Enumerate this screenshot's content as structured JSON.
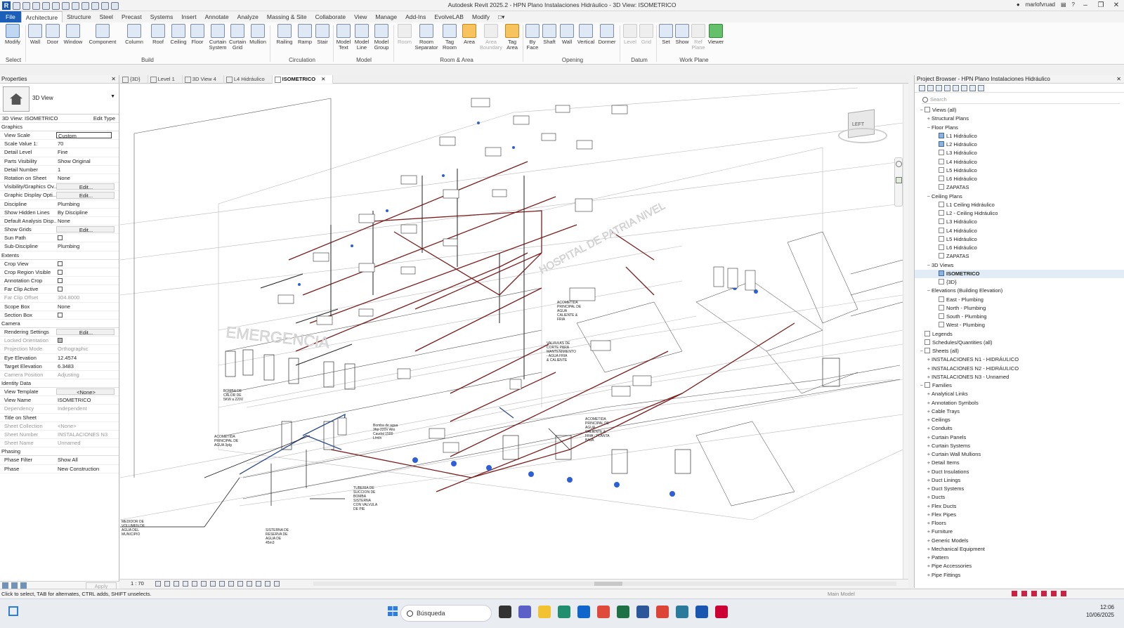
{
  "app": {
    "title": "Autodesk Revit 2025.2 - HPN Plano Instalaciones Hidráulico - 3D View: ISOMETRICO",
    "user": "marlofvruad"
  },
  "ribbon_tabs": [
    "File",
    "Architecture",
    "Structure",
    "Steel",
    "Precast",
    "Systems",
    "Insert",
    "Annotate",
    "Analyze",
    "Massing & Site",
    "Collaborate",
    "View",
    "Manage",
    "Add-Ins",
    "EvolveLAB",
    "Modify"
  ],
  "ribbon_active": "Architecture",
  "tools": {
    "modify": "Modify",
    "wall": "Wall",
    "door": "Door",
    "window": "Window",
    "component": "Component",
    "column": "Column",
    "roof": "Roof",
    "ceiling": "Ceiling",
    "floor": "Floor",
    "curtain_system": "Curtain System",
    "curtain_grid": "Curtain Grid",
    "mullion": "Mullion",
    "railing": "Railing",
    "ramp": "Ramp",
    "stair": "Stair",
    "model_text": "Model Text",
    "model_line": "Model Line",
    "model_group": "Model Group",
    "room": "Room",
    "room_separator": "Room Separator",
    "tag_room": "Tag Room",
    "area": "Area",
    "area_boundary": "Area Boundary",
    "tag_area": "Tag Area",
    "by_face": "By Face",
    "shaft": "Shaft",
    "wall_opening": "Wall",
    "vertical": "Vertical",
    "dormer": "Dormer",
    "level": "Level",
    "grid": "Grid",
    "set": "Set",
    "show": "Show",
    "ref_plane": "Ref Plane",
    "viewer": "Viewer"
  },
  "panels": {
    "select": "Select",
    "build": "Build",
    "circulation": "Circulation",
    "model": "Model",
    "room_area": "Room & Area",
    "opening": "Opening",
    "datum": "Datum",
    "work_plane": "Work Plane"
  },
  "properties": {
    "title": "Properties",
    "type_name": "3D View",
    "instance": "3D View: ISOMETRICO",
    "edit_type": "Edit Type",
    "groups": [
      {
        "name": "Graphics",
        "rows": [
          {
            "k": "View Scale",
            "v": "Custom",
            "kind": "input"
          },
          {
            "k": "Scale Value    1:",
            "v": "70"
          },
          {
            "k": "Detail Level",
            "v": "Fine"
          },
          {
            "k": "Parts Visibility",
            "v": "Show Original"
          },
          {
            "k": "Detail Number",
            "v": "1"
          },
          {
            "k": "Rotation on Sheet",
            "v": "None"
          },
          {
            "k": "Visibility/Graphics Ov...",
            "v": "Edit...",
            "kind": "btn"
          },
          {
            "k": "Graphic Display Opti...",
            "v": "Edit...",
            "kind": "btn"
          },
          {
            "k": "Discipline",
            "v": "Plumbing"
          },
          {
            "k": "Show Hidden Lines",
            "v": "By Discipline"
          },
          {
            "k": "Default Analysis Disp...",
            "v": "None"
          },
          {
            "k": "Show Grids",
            "v": "Edit...",
            "kind": "btn"
          },
          {
            "k": "Sun Path",
            "v": "",
            "kind": "check"
          },
          {
            "k": "Sub-Discipline",
            "v": "Plumbing"
          }
        ]
      },
      {
        "name": "Extents",
        "rows": [
          {
            "k": "Crop View",
            "v": "",
            "kind": "check"
          },
          {
            "k": "Crop Region Visible",
            "v": "",
            "kind": "check"
          },
          {
            "k": "Annotation Crop",
            "v": "",
            "kind": "check"
          },
          {
            "k": "Far Clip Active",
            "v": "",
            "kind": "check"
          },
          {
            "k": "Far Clip Offset",
            "v": "304.8000",
            "dim": true
          },
          {
            "k": "Scope Box",
            "v": "None"
          },
          {
            "k": "Section Box",
            "v": "",
            "kind": "check"
          }
        ]
      },
      {
        "name": "Camera",
        "rows": [
          {
            "k": "Rendering Settings",
            "v": "Edit...",
            "kind": "btn"
          },
          {
            "k": "Locked Orientation",
            "v": "",
            "kind": "checkon",
            "dim": true
          },
          {
            "k": "Projection Mode",
            "v": "Orthographic",
            "dim": true
          },
          {
            "k": "Eye Elevation",
            "v": "12.4574"
          },
          {
            "k": "Target Elevation",
            "v": "6.3483"
          },
          {
            "k": "Camera Position",
            "v": "Adjusting",
            "dim": true
          }
        ]
      },
      {
        "name": "Identity Data",
        "rows": [
          {
            "k": "View Template",
            "v": "<None>",
            "kind": "btn"
          },
          {
            "k": "View Name",
            "v": "ISOMETRICO"
          },
          {
            "k": "Dependency",
            "v": "Independent",
            "dim": true
          },
          {
            "k": "Title on Sheet",
            "v": ""
          },
          {
            "k": "Sheet Collection",
            "v": "<None>",
            "dim": true
          },
          {
            "k": "Sheet Number",
            "v": "INSTALACIONES N3",
            "dim": true
          },
          {
            "k": "Sheet Name",
            "v": "Unnamed",
            "dim": true
          }
        ]
      },
      {
        "name": "Phasing",
        "rows": [
          {
            "k": "Phase Filter",
            "v": "Show All"
          },
          {
            "k": "Phase",
            "v": "New Construction"
          }
        ]
      }
    ],
    "apply": "Apply"
  },
  "view_tabs": [
    {
      "label": "{3D}"
    },
    {
      "label": "Level 1"
    },
    {
      "label": "3D View 4"
    },
    {
      "label": "L4 Hidráulico"
    },
    {
      "label": "ISOMETRICO",
      "active": true
    }
  ],
  "view_scale": "1 : 70",
  "viewcube": "LEFT",
  "annotations": {
    "emergencia": "EMERGENCIA",
    "hospital": "HOSPITAL DE PATRIA NIVEL",
    "acometida1": [
      "ACOMETIDA",
      "PRINCIPAL DE",
      "AGUA",
      "CALIENTE &",
      "FRIA"
    ],
    "valvulas": [
      "VALVULAS DE",
      "CORTE PARA",
      "MANTENIMIENTO",
      "- AGUA FRIA",
      "& CALIENTE"
    ],
    "bomba_calor": [
      "BOMBA DE",
      "CALOR DE",
      "5KW a 220V"
    ],
    "acometida3": [
      "ACOMETIDA",
      "PRINCIPAL DE",
      "AGUA 3plg"
    ],
    "bomba_agua": [
      "Bomba de agua",
      "3hp-220V Alto",
      "Caudal 1500",
      "L/min"
    ],
    "acometida_baja": [
      "ACOMETIDA",
      "PRINCIPAL DE",
      "AGUA",
      "CALIENTE &",
      "FRIA - PLANTA",
      "BAJA"
    ],
    "tuberia": [
      "TUBERIA DE",
      "SUCCION DE",
      "BOMBA",
      "SISTERNA",
      "CON VALVULA",
      "DE PIE"
    ],
    "medidor": [
      "MEDIDOR DE",
      "VOLUMEN DE",
      "AGUA DEL",
      "MUNICIPIO"
    ],
    "sisterna": [
      "SISTERNA DE",
      "RESERVA DE",
      "AGUA DE",
      "45m3"
    ]
  },
  "browser": {
    "title": "Project Browser - HPN Plano Instalaciones Hidráulico",
    "search_placeholder": "Search",
    "tree": [
      {
        "t": "Views (all)",
        "d": 0,
        "tg": "−",
        "ic": true
      },
      {
        "t": "Structural Plans",
        "d": 1,
        "tg": "+"
      },
      {
        "t": "Floor Plans",
        "d": 1,
        "tg": "−"
      },
      {
        "t": "L1 Hidráulico",
        "d": 2,
        "ic": "blue"
      },
      {
        "t": "L2 Hidráulico",
        "d": 2,
        "ic": "blue"
      },
      {
        "t": "L3 Hidráulico",
        "d": 2,
        "ic": true
      },
      {
        "t": "L4 Hidráulico",
        "d": 2,
        "ic": true
      },
      {
        "t": "L5 Hidráulico",
        "d": 2,
        "ic": true
      },
      {
        "t": "L6 Hidráulico",
        "d": 2,
        "ic": true
      },
      {
        "t": "ZAPATAS",
        "d": 2,
        "ic": true
      },
      {
        "t": "Ceiling Plans",
        "d": 1,
        "tg": "−"
      },
      {
        "t": "L1 Ceiling Hidráulico",
        "d": 2,
        "ic": true
      },
      {
        "t": "L2 - Ceiling Hidráulico",
        "d": 2,
        "ic": true
      },
      {
        "t": "L3 Hidráulico",
        "d": 2,
        "ic": true
      },
      {
        "t": "L4 Hidráulico",
        "d": 2,
        "ic": true
      },
      {
        "t": "L5 Hidráulico",
        "d": 2,
        "ic": true
      },
      {
        "t": "L6 Hidráulico",
        "d": 2,
        "ic": true
      },
      {
        "t": "ZAPATAS",
        "d": 2,
        "ic": true
      },
      {
        "t": "3D Views",
        "d": 1,
        "tg": "−"
      },
      {
        "t": "ISOMETRICO",
        "d": 2,
        "ic": "blue",
        "sel": true
      },
      {
        "t": "{3D}",
        "d": 2,
        "ic": true
      },
      {
        "t": "Elevations (Building Elevation)",
        "d": 1,
        "tg": "−"
      },
      {
        "t": "East - Plumbing",
        "d": 2,
        "ic": true
      },
      {
        "t": "North - Plumbing",
        "d": 2,
        "ic": true
      },
      {
        "t": "South - Plumbing",
        "d": 2,
        "ic": true
      },
      {
        "t": "West - Plumbing",
        "d": 2,
        "ic": true
      },
      {
        "t": "Legends",
        "d": 0,
        "ic": true
      },
      {
        "t": "Schedules/Quantities (all)",
        "d": 0,
        "ic": true
      },
      {
        "t": "Sheets (all)",
        "d": 0,
        "tg": "−",
        "ic": true
      },
      {
        "t": "INSTALACIONES N1 - HIDRÁULICO",
        "d": 1,
        "tg": "+"
      },
      {
        "t": "INSTALACIONES N2 - HIDRÁULICO",
        "d": 1,
        "tg": "+"
      },
      {
        "t": "INSTALACIONES N3 - Unnamed",
        "d": 1,
        "tg": "+"
      },
      {
        "t": "Families",
        "d": 0,
        "tg": "−",
        "ic": true
      },
      {
        "t": "Analytical Links",
        "d": 1,
        "tg": "+"
      },
      {
        "t": "Annotation Symbols",
        "d": 1,
        "tg": "+"
      },
      {
        "t": "Cable Trays",
        "d": 1,
        "tg": "+"
      },
      {
        "t": "Ceilings",
        "d": 1,
        "tg": "+"
      },
      {
        "t": "Conduits",
        "d": 1,
        "tg": "+"
      },
      {
        "t": "Curtain Panels",
        "d": 1,
        "tg": "+"
      },
      {
        "t": "Curtain Systems",
        "d": 1,
        "tg": "+"
      },
      {
        "t": "Curtain Wall Mullions",
        "d": 1,
        "tg": "+"
      },
      {
        "t": "Detail Items",
        "d": 1,
        "tg": "+"
      },
      {
        "t": "Duct Insulations",
        "d": 1,
        "tg": "+"
      },
      {
        "t": "Duct Linings",
        "d": 1,
        "tg": "+"
      },
      {
        "t": "Duct Systems",
        "d": 1,
        "tg": "+"
      },
      {
        "t": "Ducts",
        "d": 1,
        "tg": "+"
      },
      {
        "t": "Flex Ducts",
        "d": 1,
        "tg": "+"
      },
      {
        "t": "Flex Pipes",
        "d": 1,
        "tg": "+"
      },
      {
        "t": "Floors",
        "d": 1,
        "tg": "+"
      },
      {
        "t": "Furniture",
        "d": 1,
        "tg": "+"
      },
      {
        "t": "Generic Models",
        "d": 1,
        "tg": "+"
      },
      {
        "t": "Mechanical Equipment",
        "d": 1,
        "tg": "+"
      },
      {
        "t": "Pattern",
        "d": 1,
        "tg": "+"
      },
      {
        "t": "Pipe Accessories",
        "d": 1,
        "tg": "+"
      },
      {
        "t": "Pipe Fittings",
        "d": 1,
        "tg": "+"
      }
    ]
  },
  "status": {
    "message": "Click to select, TAB for alternates, CTRL adds, SHIFT unselects.",
    "model": "Main Model"
  },
  "taskbar": {
    "search": "Búsqueda",
    "time": "12:06",
    "date": "10/06/2025"
  }
}
